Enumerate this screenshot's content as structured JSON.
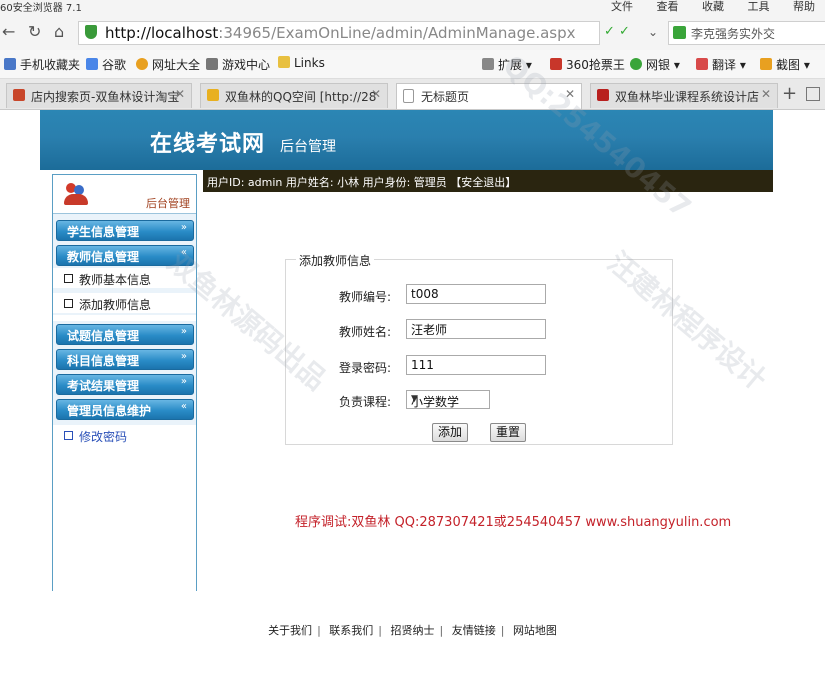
{
  "browser": {
    "title": "60安全浏览器 7.1",
    "menus": [
      "文件",
      "查看",
      "收藏",
      "工具",
      "帮助"
    ],
    "url_host": "http://localhost",
    "url_path": ":34965/ExamOnLine/admin/AdminManage.aspx",
    "search_text": "李克强务实外交",
    "favorites": [
      "手机收藏夹",
      "谷歌",
      "网址大全",
      "游戏中心",
      "Links"
    ],
    "extensions": [
      "扩展",
      "360抢票王",
      "网银",
      "翻译",
      "截图"
    ],
    "tabs": [
      {
        "label": "店内搜索页-双鱼林设计淘宝",
        "icon_color": "#c8462a",
        "active": false
      },
      {
        "label": "双鱼林的QQ空间 [http://28",
        "icon_color": "#e8b020",
        "active": false
      },
      {
        "label": "无标题页",
        "icon_color": "#ffffff",
        "active": true
      },
      {
        "label": "双鱼林毕业课程系统设计店",
        "icon_color": "#b8201e",
        "active": false
      }
    ]
  },
  "header": {
    "logo": "在线考试网",
    "subtitle": "后台管理"
  },
  "infobar": {
    "text": "用户ID: admin  用户姓名: 小林  用户身份: 管理员 【安全退出】"
  },
  "sidebar": {
    "top_label": "后台管理",
    "groups": [
      {
        "label": "学生信息管理"
      },
      {
        "label": "教师信息管理",
        "items": [
          "教师基本信息",
          "添加教师信息"
        ]
      },
      {
        "label": "试题信息管理"
      },
      {
        "label": "科目信息管理"
      },
      {
        "label": "考试结果管理"
      },
      {
        "label": "管理员信息维护",
        "items": [
          "修改密码"
        ]
      }
    ]
  },
  "form": {
    "legend": "添加教师信息",
    "teacher_no_label": "教师编号:",
    "teacher_no_value": "t008",
    "teacher_name_label": "教师姓名:",
    "teacher_name_value": "汪老师",
    "password_label": "登录密码:",
    "password_value": "111",
    "course_label": "负责课程:",
    "course_value": "小学数学",
    "add_button": "添加",
    "reset_button": "重置"
  },
  "credit": "程序调试:双鱼林 QQ:287307421或254540457 www.shuangyulin.com",
  "footer": [
    "关于我们",
    "联系我们",
    "招贤纳士",
    "友情链接",
    "网站地图"
  ],
  "watermarks": [
    "QQ:254540457",
    "汪建林程序设计",
    "双鱼林源码出品"
  ]
}
